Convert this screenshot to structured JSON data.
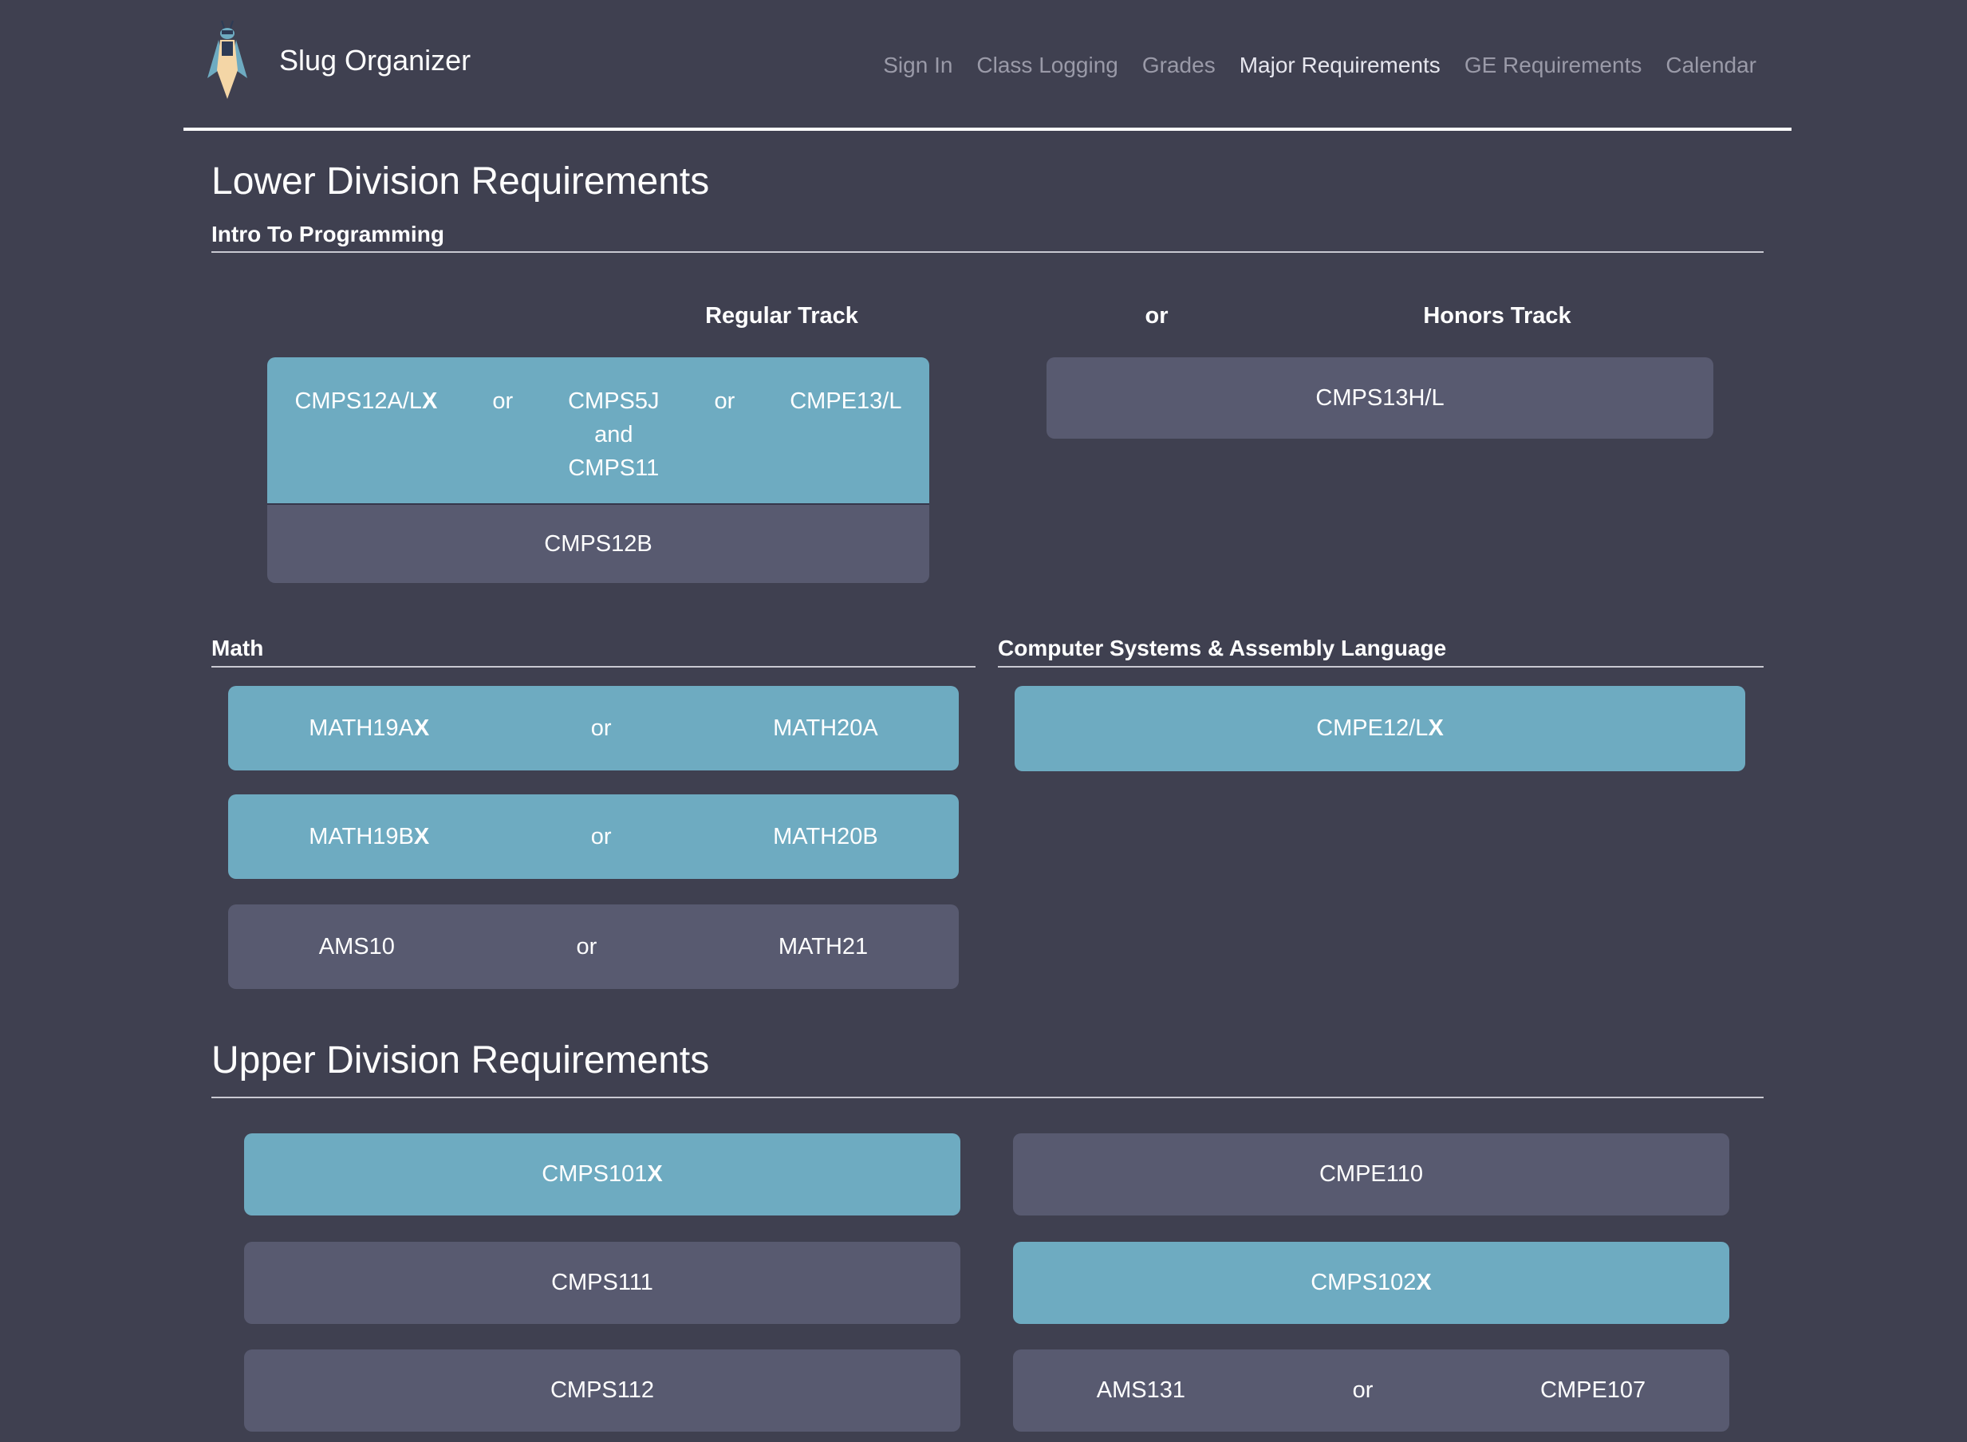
{
  "brand": {
    "name": "Slug Organizer"
  },
  "nav": [
    {
      "label": "Sign In",
      "active": false
    },
    {
      "label": "Class Logging",
      "active": false
    },
    {
      "label": "Grades",
      "active": false
    },
    {
      "label": "Major Requirements",
      "active": true
    },
    {
      "label": "GE Requirements",
      "active": false
    },
    {
      "label": "Calendar",
      "active": false
    }
  ],
  "lower": {
    "title": "Lower Division Requirements",
    "intro": {
      "title": "Intro To Programming",
      "regular_label": "Regular Track",
      "or_label": "or",
      "honors_label": "Honors Track",
      "regular_top": {
        "a": "CMPS12A/L",
        "a_mark": "X",
        "or1": "or",
        "b1": "CMPS5J",
        "b2": "and",
        "b3": "CMPS11",
        "or2": "or",
        "c": "CMPE13/L"
      },
      "regular_bottom": "CMPS12B",
      "honors": "CMPS13H/L"
    },
    "math": {
      "title": "Math",
      "rows": [
        {
          "left": "MATH19A",
          "left_mark": "X",
          "or": "or",
          "right": "MATH20A"
        },
        {
          "left": "MATH19B",
          "left_mark": "X",
          "or": "or",
          "right": "MATH20B"
        },
        {
          "left": "AMS10",
          "left_mark": "",
          "or": "or",
          "right": "MATH21"
        }
      ]
    },
    "systems": {
      "title": "Computer Systems & Assembly Language",
      "course": "CMPE12/L",
      "mark": "X"
    }
  },
  "upper": {
    "title": "Upper Division Requirements",
    "cmps101": "CMPS101",
    "cmps101_mark": "X",
    "cmpe110": "CMPE110",
    "cmps111": "CMPS111",
    "cmps102": "CMPS102",
    "cmps102_mark": "X",
    "cmps112": "CMPS112",
    "ams131": "AMS131",
    "or": "or",
    "cmpe107": "CMPE107"
  },
  "colors": {
    "background": "#3f4050",
    "completed": "#6eabc1",
    "pending": "#585a70"
  }
}
